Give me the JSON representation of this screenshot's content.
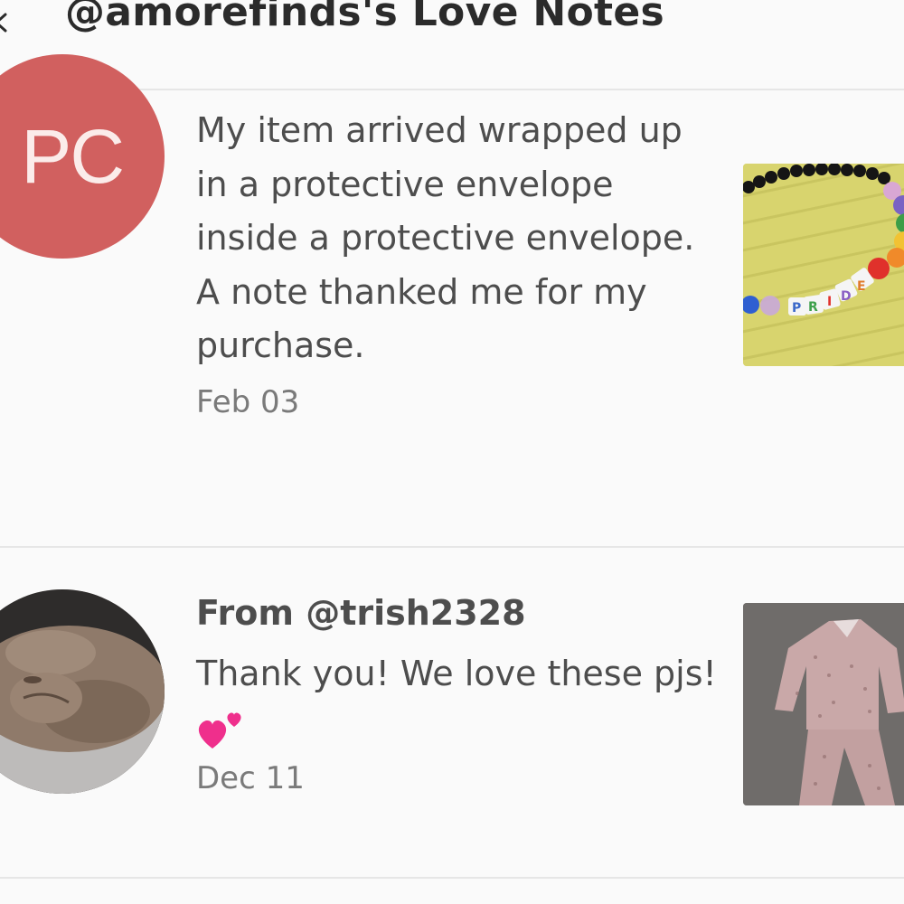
{
  "header": {
    "title": "@amorefinds's Love Notes"
  },
  "notes": [
    {
      "avatar_initials": "PC",
      "from": "",
      "text": "My item arrived wrapped up in a protective envelope inside a protective envelope. A note thanked me for my purchase.",
      "date": "Feb 03",
      "thumbnail": "rainbow-pride-bead-bracelet",
      "bracelet_text": "PRIDE"
    },
    {
      "avatar_initials": "",
      "from": "From @trish2328",
      "text": "Thank you! We love these pjs!",
      "emoji": "two-hearts",
      "date": "Dec 11",
      "thumbnail": "leopard-print-pajamas"
    }
  ],
  "colors": {
    "avatar_pc": "#d1605f",
    "divider": "#e6e6e6",
    "heart_pink": "#ef2f8c"
  }
}
